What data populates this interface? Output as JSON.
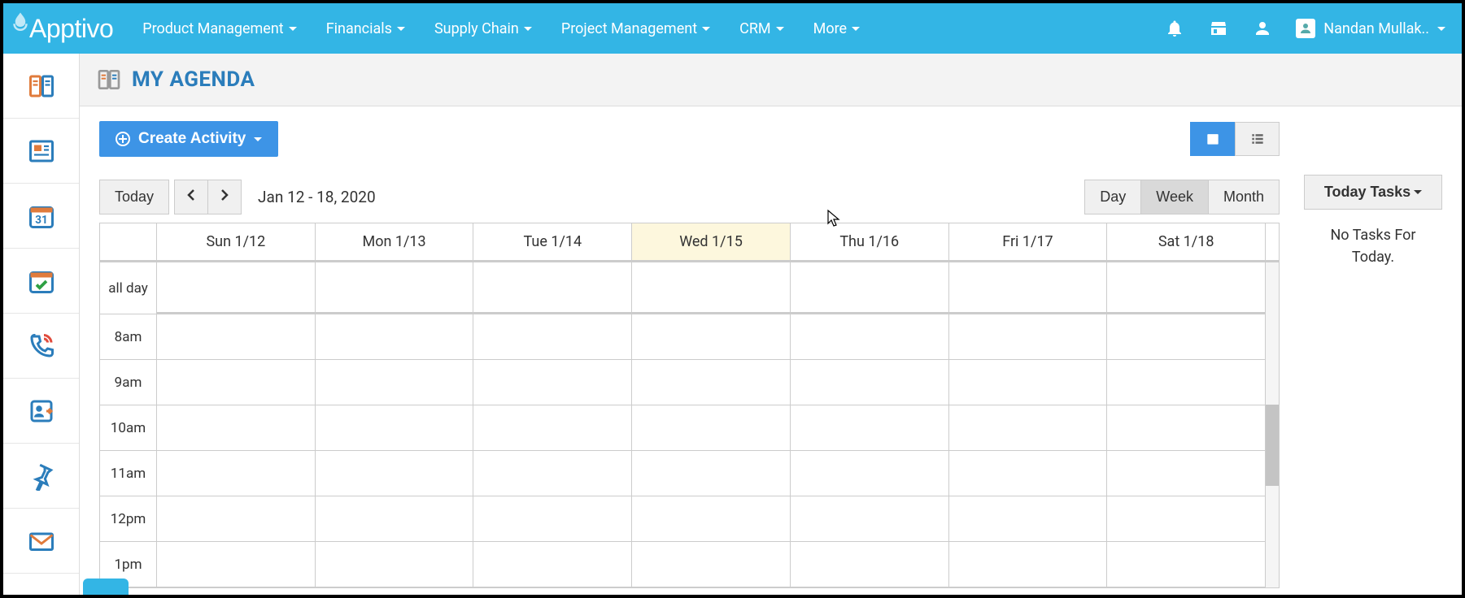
{
  "brand": "Apptivo",
  "nav": [
    {
      "label": "Product Management"
    },
    {
      "label": "Financials"
    },
    {
      "label": "Supply Chain"
    },
    {
      "label": "Project Management"
    },
    {
      "label": "CRM"
    },
    {
      "label": "More"
    }
  ],
  "user_name": "Nandan Mullak..",
  "page_title": "MY AGENDA",
  "create_label": "Create Activity",
  "today_label": "Today",
  "date_range": "Jan 12 - 18, 2020",
  "view_day": "Day",
  "view_week": "Week",
  "view_month": "Month",
  "days": [
    {
      "label": "Sun 1/12",
      "today": false
    },
    {
      "label": "Mon 1/13",
      "today": false
    },
    {
      "label": "Tue 1/14",
      "today": false
    },
    {
      "label": "Wed 1/15",
      "today": true
    },
    {
      "label": "Thu 1/16",
      "today": false
    },
    {
      "label": "Fri 1/17",
      "today": false
    },
    {
      "label": "Sat 1/18",
      "today": false
    }
  ],
  "times": [
    "all day",
    "8am",
    "9am",
    "10am",
    "11am",
    "12pm",
    "1pm"
  ],
  "today_tasks_label": "Today Tasks",
  "no_tasks_line1": "No Tasks For",
  "no_tasks_line2": "Today."
}
